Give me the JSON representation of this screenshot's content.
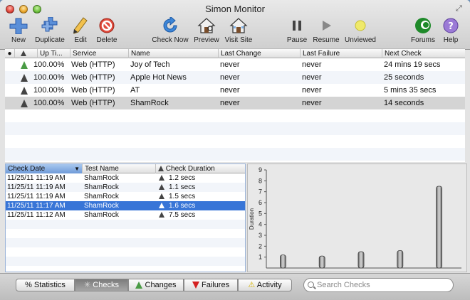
{
  "window": {
    "title": "Simon Monitor"
  },
  "toolbar": {
    "new": "New",
    "duplicate": "Duplicate",
    "edit": "Edit",
    "delete": "Delete",
    "check_now": "Check Now",
    "preview": "Preview",
    "visit_site": "Visit Site",
    "pause": "Pause",
    "resume": "Resume",
    "unviewed": "Unviewed",
    "forums": "Forums",
    "help": "Help"
  },
  "columns": {
    "uptime": "Up Ti...",
    "service": "Service",
    "name": "Name",
    "last_change": "Last Change",
    "last_failure": "Last Failure",
    "next_check": "Next Check"
  },
  "monitors": [
    {
      "uptime": "100.00%",
      "service": "Web (HTTP)",
      "name": "Joy of Tech",
      "last_change": "never",
      "last_failure": "never",
      "next_check": "24 mins 19 secs",
      "status": "up"
    },
    {
      "uptime": "100.00%",
      "service": "Web (HTTP)",
      "name": "Apple Hot News",
      "last_change": "never",
      "last_failure": "never",
      "next_check": "25 seconds",
      "status": "neutral"
    },
    {
      "uptime": "100.00%",
      "service": "Web (HTTP)",
      "name": "AT",
      "last_change": "never",
      "last_failure": "never",
      "next_check": "5 mins 35 secs",
      "status": "neutral"
    },
    {
      "uptime": "100.00%",
      "service": "Web (HTTP)",
      "name": "ShamRock",
      "last_change": "never",
      "last_failure": "never",
      "next_check": "14 seconds",
      "status": "neutral",
      "selected": true
    }
  ],
  "checks_table": {
    "columns": {
      "check_date": "Check Date",
      "test_name": "Test Name",
      "check_duration": "Check Duration"
    },
    "rows": [
      {
        "date": "11/25/11 11:19 AM",
        "test": "ShamRock",
        "duration": "1.2 secs"
      },
      {
        "date": "11/25/11 11:19 AM",
        "test": "ShamRock",
        "duration": "1.1 secs"
      },
      {
        "date": "11/25/11 11:19 AM",
        "test": "ShamRock",
        "duration": "1.5 secs"
      },
      {
        "date": "11/25/11 11:17 AM",
        "test": "ShamRock",
        "duration": "1.6 secs",
        "selected": true
      },
      {
        "date": "11/25/11 11:12 AM",
        "test": "ShamRock",
        "duration": "7.5 secs"
      }
    ]
  },
  "chart_data": {
    "type": "bar",
    "ylabel": "Duration",
    "ylim": [
      0,
      9
    ],
    "yticks": [
      "1",
      "2",
      "3",
      "4",
      "5",
      "6",
      "7",
      "8",
      "9"
    ],
    "values": [
      1.2,
      1.1,
      1.5,
      1.6,
      7.5
    ],
    "grid": false
  },
  "tabs": {
    "statistics": "Statistics",
    "checks": "Checks",
    "changes": "Changes",
    "failures": "Failures",
    "activity": "Activity"
  },
  "search": {
    "placeholder": "Search Checks"
  },
  "colors": {
    "selection": "#3875d7",
    "up_status": "#4a9b45",
    "failure": "#d42020",
    "activity": "#e8c200"
  }
}
